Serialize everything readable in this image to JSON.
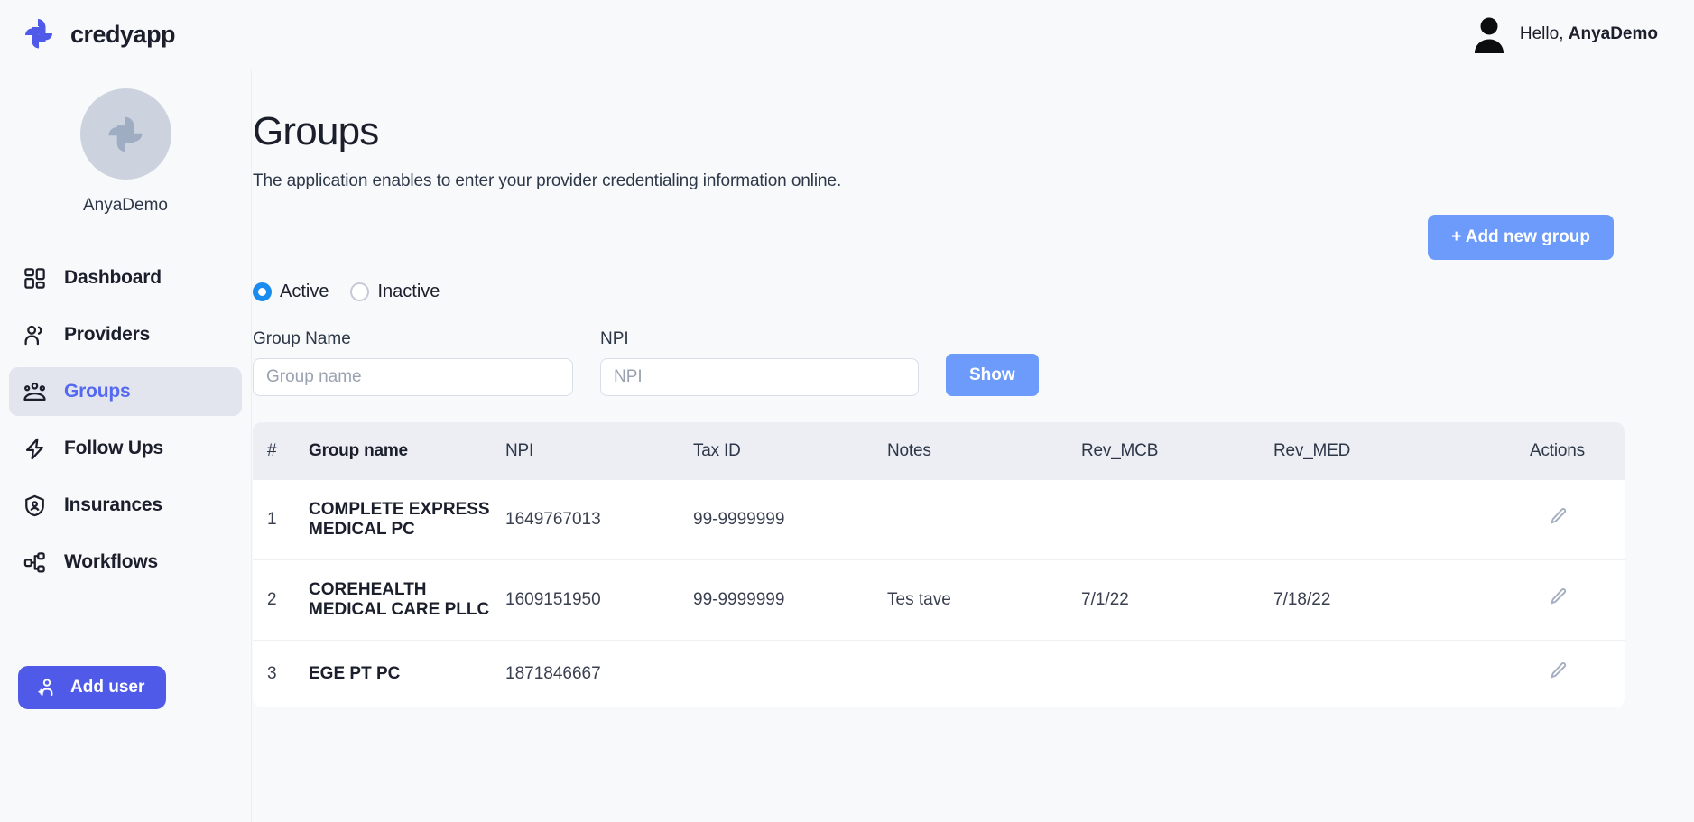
{
  "brand": {
    "name": "credyapp",
    "logo_icon": "credyapp-pinwheel-logo"
  },
  "header": {
    "greeting_prefix": "Hello,",
    "username": "AnyaDemo",
    "avatar_icon": "user-avatar-icon"
  },
  "sidebar": {
    "profile": {
      "name": "AnyaDemo",
      "avatar_icon": "credyapp-pinwheel-avatar"
    },
    "items": [
      {
        "label": "Dashboard",
        "icon": "grid-dashboard-icon",
        "active": false
      },
      {
        "label": "Providers",
        "icon": "users-icon",
        "active": false
      },
      {
        "label": "Groups",
        "icon": "group-people-icon",
        "active": true
      },
      {
        "label": "Follow Ups",
        "icon": "lightning-bolt-icon",
        "active": false
      },
      {
        "label": "Insurances",
        "icon": "shield-user-icon",
        "active": false
      },
      {
        "label": "Workflows",
        "icon": "workflow-nodes-icon",
        "active": false
      }
    ],
    "add_user_button": {
      "label": "Add user",
      "icon": "add-user-icon"
    }
  },
  "main": {
    "title": "Groups",
    "subtitle": "The application enables to enter your provider credentialing information online.",
    "add_new_group_label": "+ Add new group",
    "status_filter": {
      "options": [
        {
          "label": "Active",
          "checked": true
        },
        {
          "label": "Inactive",
          "checked": false
        }
      ]
    },
    "filters": {
      "group_name": {
        "label": "Group Name",
        "placeholder": "Group name",
        "value": ""
      },
      "npi": {
        "label": "NPI",
        "placeholder": "NPI",
        "value": ""
      },
      "show_button": "Show"
    },
    "table": {
      "columns": [
        "#",
        "Group name",
        "NPI",
        "Tax ID",
        "Notes",
        "Rev_MCB",
        "Rev_MED",
        "Actions"
      ],
      "rows": [
        {
          "index": "1",
          "group_name": "COMPLETE EXPRESS MEDICAL PC",
          "npi": "1649767013",
          "tax_id": "99-9999999",
          "notes": "",
          "rev_mcb": "",
          "rev_med": "",
          "action_icon": "edit-pencil-icon"
        },
        {
          "index": "2",
          "group_name": "COREHEALTH MEDICAL CARE PLLC",
          "npi": "1609151950",
          "tax_id": "99-9999999",
          "notes": "Tes tave",
          "rev_mcb": "7/1/22",
          "rev_med": "7/18/22",
          "action_icon": "edit-pencil-icon"
        },
        {
          "index": "3",
          "group_name": "EGE PT PC",
          "npi": "1871846667",
          "tax_id": "",
          "notes": "",
          "rev_mcb": "",
          "rev_med": "",
          "action_icon": "edit-pencil-icon"
        }
      ]
    }
  },
  "colors": {
    "brand_blue": "#4f5ae8",
    "accent_button": "#6c9bfb",
    "active_nav_text": "#5469f0",
    "active_nav_bg": "#e2e5ee",
    "radio_checked": "#1a8cf0",
    "page_bg": "#f8f9fb",
    "table_header_bg": "#eceef4",
    "pencil_icon": "#a5aec0"
  }
}
